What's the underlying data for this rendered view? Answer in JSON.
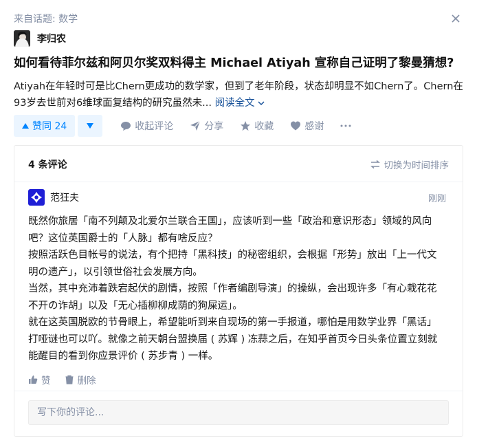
{
  "topic": {
    "label": "来自话题: 数学"
  },
  "author": {
    "name": "李归农"
  },
  "question": {
    "title": "如何看待菲尔兹和阿贝尔奖双料得主 Michael Atiyah 宣称自己证明了黎曼猜想?"
  },
  "answer": {
    "excerpt": "Atiyah在年轻时可是比Chern更成功的数学家，但到了老年阶段，状态却明显不如Chern了。Chern在93岁去世前对6维球面复结构的研究虽然未...",
    "read_full": "阅读全文"
  },
  "actions": {
    "vote_up": "赞同 24",
    "collapse_comments": "收起评论",
    "share": "分享",
    "favorite": "收藏",
    "thanks": "感谢",
    "more": "···"
  },
  "comments": {
    "count_label": "4 条评论",
    "sort_label": "切换为时间排序",
    "items": [
      {
        "user": "范狂夫",
        "time": "刚刚",
        "paragraphs": [
          "既然你旅居「南不列颠及北爱尔兰联合王国」，应该听到一些「政治和意识形态」领域的风向吧？这位英国爵士的「人脉」都有啥反应？",
          "按照活跃色目帐号的说法，有个把持「黑科技」的秘密组织，会根据「形势」放出「上一代文明の遗产」，以引领世俗社会发展方向。",
          "当然，其中充沛着跌宕起伏的剧情，按照「作者编剧导演」的操纵，会出现许多「有心栽花花不开の诈胡」以及「无心插柳柳成荫的狗屎运」。",
          "就在这英国脱欧的节骨眼上，希望能听到来自现场的第一手报道，哪怕是用数学业界「黑话」打哑谜也可以吖。就像之前天朝台盟换届 ( 苏辉 ) 冻蒜之后，在知乎首页今日头条位置立刻就能醒目的看到你应景评价 ( 苏步青 ) 一样。"
        ],
        "like_label": "赞",
        "delete_label": "删除"
      }
    ],
    "input_placeholder": "写下你的评论..."
  },
  "colors": {
    "accent": "#0084ff",
    "muted": "#8590a6",
    "link": "#175199"
  }
}
